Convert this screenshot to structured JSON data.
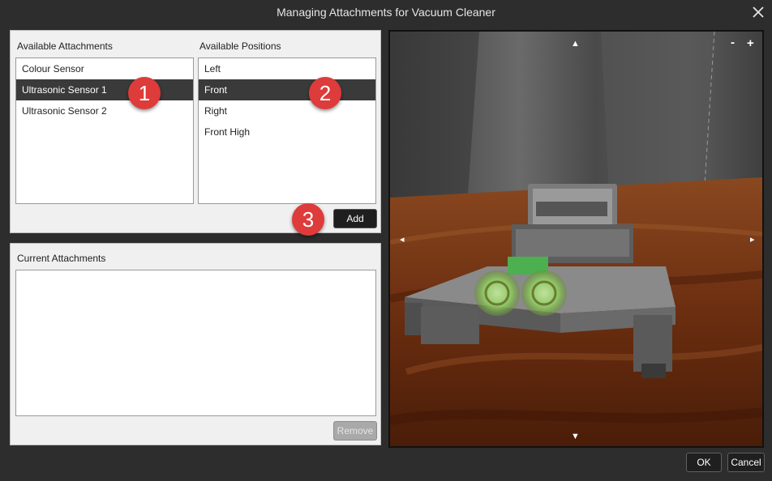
{
  "window": {
    "title": "Managing Attachments for Vacuum Cleaner"
  },
  "available_attachments": {
    "label": "Available Attachments",
    "items": [
      "Colour Sensor",
      "Ultrasonic Sensor 1",
      "Ultrasonic Sensor 2"
    ],
    "selected": "Ultrasonic Sensor 1"
  },
  "available_positions": {
    "label": "Available Positions",
    "items": [
      "Left",
      "Front",
      "Right",
      "Front High"
    ],
    "selected": "Front"
  },
  "add_button": {
    "label": "Add"
  },
  "current_attachments": {
    "label": "Current Attachments",
    "items": []
  },
  "remove_button": {
    "label": "Remove",
    "enabled": false
  },
  "viewport": {
    "controls": {
      "up": "▲",
      "down": "▼",
      "left": "◂",
      "right": "▸",
      "zoom_out": "-",
      "zoom_in": "+"
    }
  },
  "annotations": {
    "badge1": "1",
    "badge2": "2",
    "badge3": "3"
  },
  "footer": {
    "ok_label": "OK",
    "cancel_label": "Cancel"
  },
  "colors": {
    "selection": "#3a3a3a",
    "badge": "#de3b3b",
    "floor": "#7a3a17",
    "wall": "#5a5a5a"
  }
}
